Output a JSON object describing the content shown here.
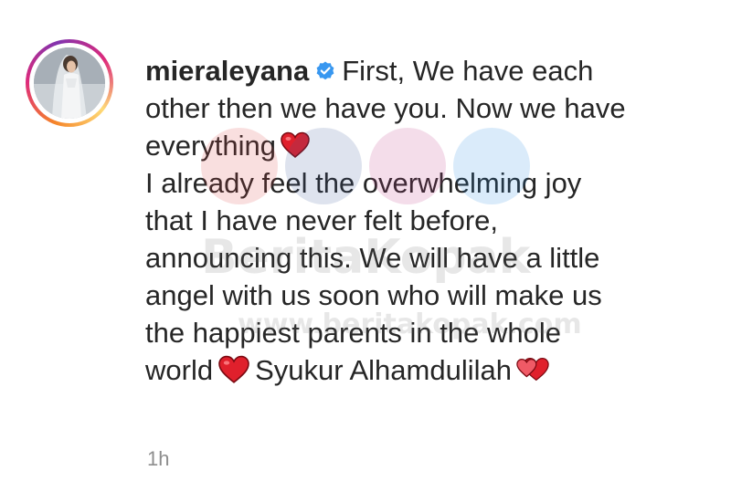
{
  "post": {
    "username": "mieraleyana",
    "lines": [
      "First, We have each",
      "other then we have you. Now we have",
      "everything",
      "I already feel the overwhelming joy",
      "that I have never felt before,",
      "announcing this. We will have a little",
      "angel with us soon who will make us",
      "the happiest parents in the whole",
      "world",
      "Syukur Alhamdulilah"
    ],
    "timestamp": "1h"
  },
  "watermark": {
    "brand": "BeritaKopak",
    "url": "www.beritakopak.com"
  },
  "icons": {
    "verified": "verified-badge-icon",
    "heart": "red-heart-icon",
    "double_heart": "two-hearts-icon"
  },
  "colors": {
    "text": "#262626",
    "timestamp": "#8e8e8e",
    "verified": "#3897f0",
    "heart": "#e0202c"
  }
}
